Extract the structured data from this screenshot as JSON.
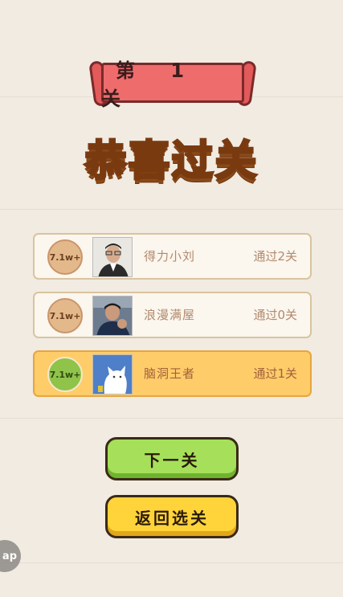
{
  "banner": {
    "level_text": "第 1 关"
  },
  "title": "恭喜过关",
  "players": [
    {
      "score_badge": "7.1w+",
      "name": "得力小刘",
      "progress": "通过2关",
      "highlight": false
    },
    {
      "score_badge": "7.1w+",
      "name": "浪漫满屋",
      "progress": "通过0关",
      "highlight": false
    },
    {
      "score_badge": "7.1w+",
      "name": "脑洞王者",
      "progress": "通过1关",
      "highlight": true
    }
  ],
  "buttons": {
    "next_label": "下一关",
    "back_label": "返回选关"
  },
  "floating": {
    "label": "ap"
  },
  "colors": {
    "background": "#f1ebe2",
    "ribbon": "#ee6c6c",
    "title_fill": "#ffd53a",
    "row_highlight": "#ffcc6a",
    "next_button": "#a6e05a",
    "back_button": "#ffd43a"
  }
}
